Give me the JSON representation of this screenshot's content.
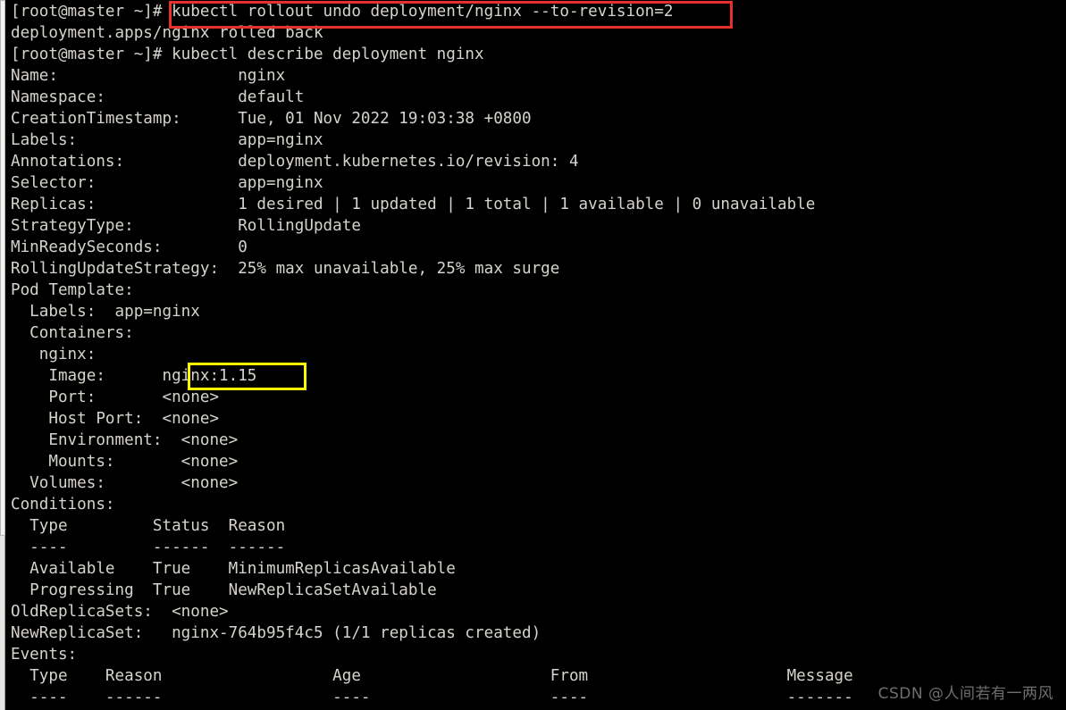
{
  "terminal": {
    "prompt": "[root@master ~]#",
    "background_color": "#000000",
    "text_color": "#d6d3cd",
    "lines": [
      "[root@master ~]# kubectl rollout undo deployment/nginx --to-revision=2",
      "deployment.apps/nginx rolled back",
      "[root@master ~]# kubectl describe deployment nginx",
      "Name:                   nginx",
      "Namespace:              default",
      "CreationTimestamp:      Tue, 01 Nov 2022 19:03:38 +0800",
      "Labels:                 app=nginx",
      "Annotations:            deployment.kubernetes.io/revision: 4",
      "Selector:               app=nginx",
      "Replicas:               1 desired | 1 updated | 1 total | 1 available | 0 unavailable",
      "StrategyType:           RollingUpdate",
      "MinReadySeconds:        0",
      "RollingUpdateStrategy:  25% max unavailable, 25% max surge",
      "Pod Template:",
      "  Labels:  app=nginx",
      "  Containers:",
      "   nginx:",
      "    Image:      nginx:1.15",
      "    Port:       <none>",
      "    Host Port:  <none>",
      "    Environment:  <none>",
      "    Mounts:       <none>",
      "  Volumes:        <none>",
      "Conditions:",
      "  Type         Status  Reason",
      "  ----         ------  ------",
      "  Available    True    MinimumReplicasAvailable",
      "  Progressing  True    NewReplicaSetAvailable",
      "OldReplicaSets:  <none>",
      "NewReplicaSet:   nginx-764b95f4c5 (1/1 replicas created)",
      "Events:",
      "  Type    Reason                  Age                    From                     Message",
      "  ----    ------                  ----                   ----                     -------"
    ]
  },
  "commands": {
    "rollout_undo": "kubectl rollout undo deployment/nginx --to-revision=2",
    "rollout_undo_output": "deployment.apps/nginx rolled back",
    "describe": "kubectl describe deployment nginx"
  },
  "deployment": {
    "name_label": "Name:",
    "name_value": "nginx",
    "namespace_label": "Namespace:",
    "namespace_value": "default",
    "creation_timestamp_label": "CreationTimestamp:",
    "creation_timestamp_value": "Tue, 01 Nov 2022 19:03:38 +0800",
    "labels_label": "Labels:",
    "labels_value": "app=nginx",
    "annotations_label": "Annotations:",
    "annotations_value": "deployment.kubernetes.io/revision: 4",
    "selector_label": "Selector:",
    "selector_value": "app=nginx",
    "replicas_label": "Replicas:",
    "replicas_value": "1 desired | 1 updated | 1 total | 1 available | 0 unavailable",
    "strategy_type_label": "StrategyType:",
    "strategy_type_value": "RollingUpdate",
    "min_ready_seconds_label": "MinReadySeconds:",
    "min_ready_seconds_value": "0",
    "rolling_update_strategy_label": "RollingUpdateStrategy:",
    "rolling_update_strategy_value": "25% max unavailable, 25% max surge",
    "old_replicasets_label": "OldReplicaSets:",
    "old_replicasets_value": "<none>",
    "new_replicaset_label": "NewReplicaSet:",
    "new_replicaset_value": "nginx-764b95f4c5 (1/1 replicas created)"
  },
  "pod_template": {
    "header": "Pod Template:",
    "labels_label": "Labels:",
    "labels_value": "app=nginx",
    "containers_header": "Containers:",
    "container_name": "nginx:",
    "image_label": "Image:",
    "image_value": "nginx:1.15",
    "port_label": "Port:",
    "port_value": "<none>",
    "host_port_label": "Host Port:",
    "host_port_value": "<none>",
    "environment_label": "Environment:",
    "environment_value": "<none>",
    "mounts_label": "Mounts:",
    "mounts_value": "<none>",
    "volumes_label": "Volumes:",
    "volumes_value": "<none>"
  },
  "conditions": {
    "header": "Conditions:",
    "columns": [
      "Type",
      "Status",
      "Reason"
    ],
    "rules": [
      "----",
      "------",
      "------"
    ],
    "rows": [
      {
        "type": "Available",
        "status": "True",
        "reason": "MinimumReplicasAvailable"
      },
      {
        "type": "Progressing",
        "status": "True",
        "reason": "NewReplicaSetAvailable"
      }
    ]
  },
  "events": {
    "header": "Events:",
    "columns": [
      "Type",
      "Reason",
      "Age",
      "From",
      "Message"
    ],
    "rules": [
      "----",
      "------",
      "----",
      "----",
      "-------"
    ],
    "rows": []
  },
  "annotations": {
    "red_box_target": "kubectl rollout undo deployment/nginx --to-revision=2",
    "red_box_color": "#e8302a",
    "yellow_box_target": "nginx:1.15",
    "yellow_box_color": "#ffff00"
  },
  "watermark": {
    "text": "CSDN @人间若有一两风"
  }
}
